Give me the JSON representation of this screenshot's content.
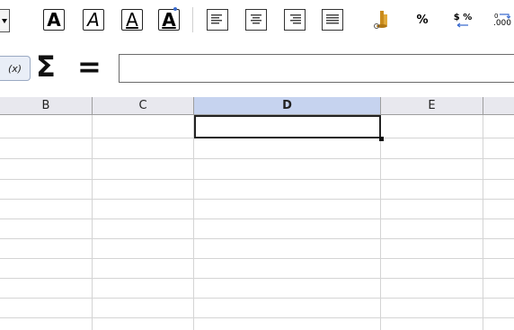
{
  "toolbar": {
    "buttons": [
      {
        "name": "font-dropdown-arrow"
      },
      {
        "name": "bold-button",
        "glyph": "A"
      },
      {
        "name": "italic-button",
        "glyph": "A"
      },
      {
        "name": "underline-button",
        "glyph": "A"
      },
      {
        "name": "font-color-button",
        "glyph": "A"
      },
      {
        "name": "align-left-button"
      },
      {
        "name": "align-center-button"
      },
      {
        "name": "align-right-button"
      },
      {
        "name": "justify-button"
      },
      {
        "name": "number-format-currency-button"
      },
      {
        "name": "percent-button",
        "glyph": "%"
      },
      {
        "name": "currency-percent-button",
        "glyph": "$ %"
      },
      {
        "name": "decimal-button",
        "glyph": ".000"
      }
    ],
    "accent_color": "#3c6ccf"
  },
  "formula_bar": {
    "fx_label": "(x)",
    "sigma_label": "Σ",
    "equals_label": "=",
    "input_value": ""
  },
  "columns": [
    {
      "label": "B"
    },
    {
      "label": "C"
    },
    {
      "label": "D",
      "selected": true
    },
    {
      "label": "E"
    },
    {
      "label": ""
    }
  ],
  "colors": {
    "header_bg": "#e8e8ee",
    "selected_header_bg": "#c6d3ef",
    "grid_line": "#d4d4d4"
  }
}
